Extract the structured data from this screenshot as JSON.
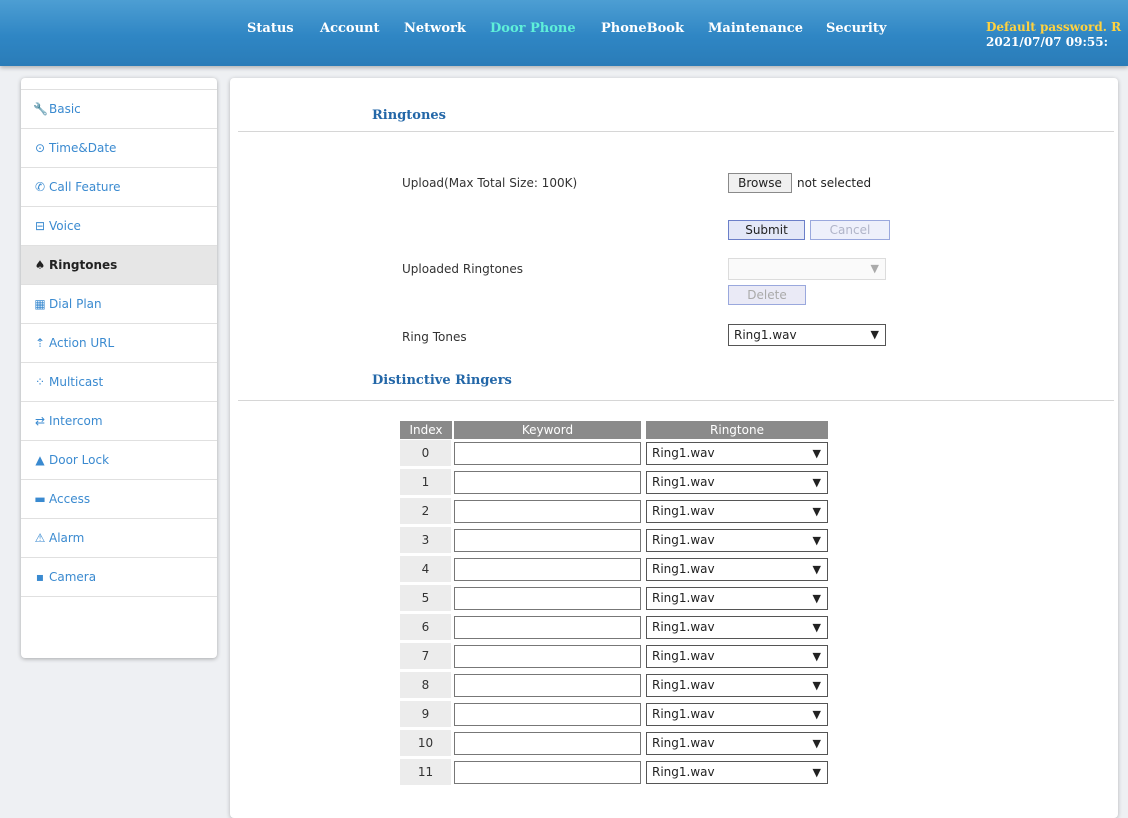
{
  "nav": {
    "items": [
      "Status",
      "Account",
      "Network",
      "Door Phone",
      "PhoneBook",
      "Maintenance",
      "Security"
    ],
    "active": "Door Phone",
    "warning": "Default password. R",
    "datetime": "2021/07/07 09:55:"
  },
  "sidebar": {
    "items": [
      {
        "label": "Basic",
        "icon": "wrench-icon",
        "glyph": "🔧"
      },
      {
        "label": "Time&Date",
        "icon": "clock-icon",
        "glyph": "⊙"
      },
      {
        "label": "Call Feature",
        "icon": "phone-icon",
        "glyph": "✆"
      },
      {
        "label": "Voice",
        "icon": "voice-icon",
        "glyph": "⊟"
      },
      {
        "label": "Ringtones",
        "icon": "bell-icon",
        "glyph": "♠"
      },
      {
        "label": "Dial Plan",
        "icon": "dialplan-icon",
        "glyph": "▦"
      },
      {
        "label": "Action URL",
        "icon": "upload-icon",
        "glyph": "⇡"
      },
      {
        "label": "Multicast",
        "icon": "multicast-icon",
        "glyph": "⁘"
      },
      {
        "label": "Intercom",
        "icon": "intercom-icon",
        "glyph": "⇄"
      },
      {
        "label": "Door Lock",
        "icon": "lock-icon",
        "glyph": "▲"
      },
      {
        "label": "Access",
        "icon": "access-card-icon",
        "glyph": "▬"
      },
      {
        "label": "Alarm",
        "icon": "alarm-icon",
        "glyph": "⚠"
      },
      {
        "label": "Camera",
        "icon": "camera-icon",
        "glyph": "▪"
      }
    ],
    "active_index": 4
  },
  "ringtones": {
    "title": "Ringtones",
    "upload_label": "Upload(Max Total Size: 100K)",
    "browse_label": "Browse",
    "file_status": "not selected",
    "submit_label": "Submit",
    "cancel_label": "Cancel",
    "uploaded_label": "Uploaded Ringtones",
    "uploaded_value": "",
    "delete_label": "Delete",
    "ring_tones_label": "Ring Tones",
    "ring_tones_value": "Ring1.wav"
  },
  "distinctive": {
    "title": "Distinctive Ringers",
    "columns": [
      "Index",
      "Keyword",
      "Ringtone"
    ],
    "rows": [
      {
        "index": "0",
        "keyword": "",
        "ringtone": "Ring1.wav"
      },
      {
        "index": "1",
        "keyword": "",
        "ringtone": "Ring1.wav"
      },
      {
        "index": "2",
        "keyword": "",
        "ringtone": "Ring1.wav"
      },
      {
        "index": "3",
        "keyword": "",
        "ringtone": "Ring1.wav"
      },
      {
        "index": "4",
        "keyword": "",
        "ringtone": "Ring1.wav"
      },
      {
        "index": "5",
        "keyword": "",
        "ringtone": "Ring1.wav"
      },
      {
        "index": "6",
        "keyword": "",
        "ringtone": "Ring1.wav"
      },
      {
        "index": "7",
        "keyword": "",
        "ringtone": "Ring1.wav"
      },
      {
        "index": "8",
        "keyword": "",
        "ringtone": "Ring1.wav"
      },
      {
        "index": "9",
        "keyword": "",
        "ringtone": "Ring1.wav"
      },
      {
        "index": "10",
        "keyword": "",
        "ringtone": "Ring1.wav"
      },
      {
        "index": "11",
        "keyword": "",
        "ringtone": "Ring1.wav"
      }
    ]
  },
  "colors": {
    "topbar": "#2f86c4",
    "nav_active": "#5ef0d9",
    "warning": "#ffd23f",
    "link": "#3a8ad0",
    "section_title": "#2367a8"
  }
}
